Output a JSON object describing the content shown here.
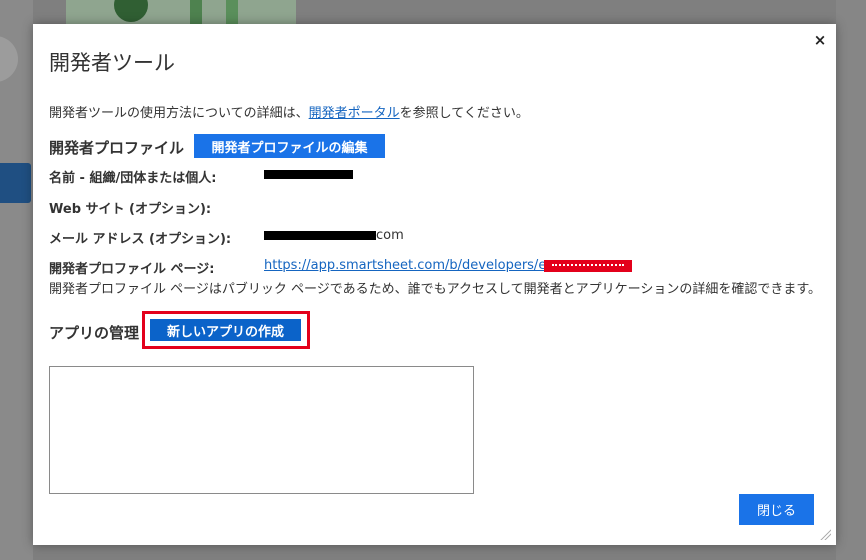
{
  "dialog": {
    "title": "開発者ツール",
    "close_glyph": "×",
    "intro": {
      "before": "開発者ツールの使用方法についての詳細は、",
      "link": "開発者ポータル",
      "after": "を参照してください。"
    }
  },
  "profile": {
    "heading": "開発者プロファイル",
    "edit_button": "開発者プロファイルの編集",
    "fields": {
      "name_label": "名前 - 組織/団体または個人:",
      "website_label": "Web サイト (オプション):",
      "email_label": "メール アドレス (オプション):",
      "email_suffix": "com",
      "page_label": "開発者プロファイル ページ:",
      "page_url": "https://app.smartsheet.com/b/developers/e"
    },
    "note": "開発者プロファイル ページはパブリック ページであるため、誰でもアクセスして開発者とアプリケーションの詳細を確認できます。"
  },
  "apps": {
    "heading": "アプリの管理",
    "new_app_button": "新しいアプリの作成"
  },
  "footer": {
    "close_button": "閉じる"
  },
  "colors": {
    "accent": "#1a73e8",
    "highlight": "#e3001b",
    "link": "#1565c0"
  }
}
